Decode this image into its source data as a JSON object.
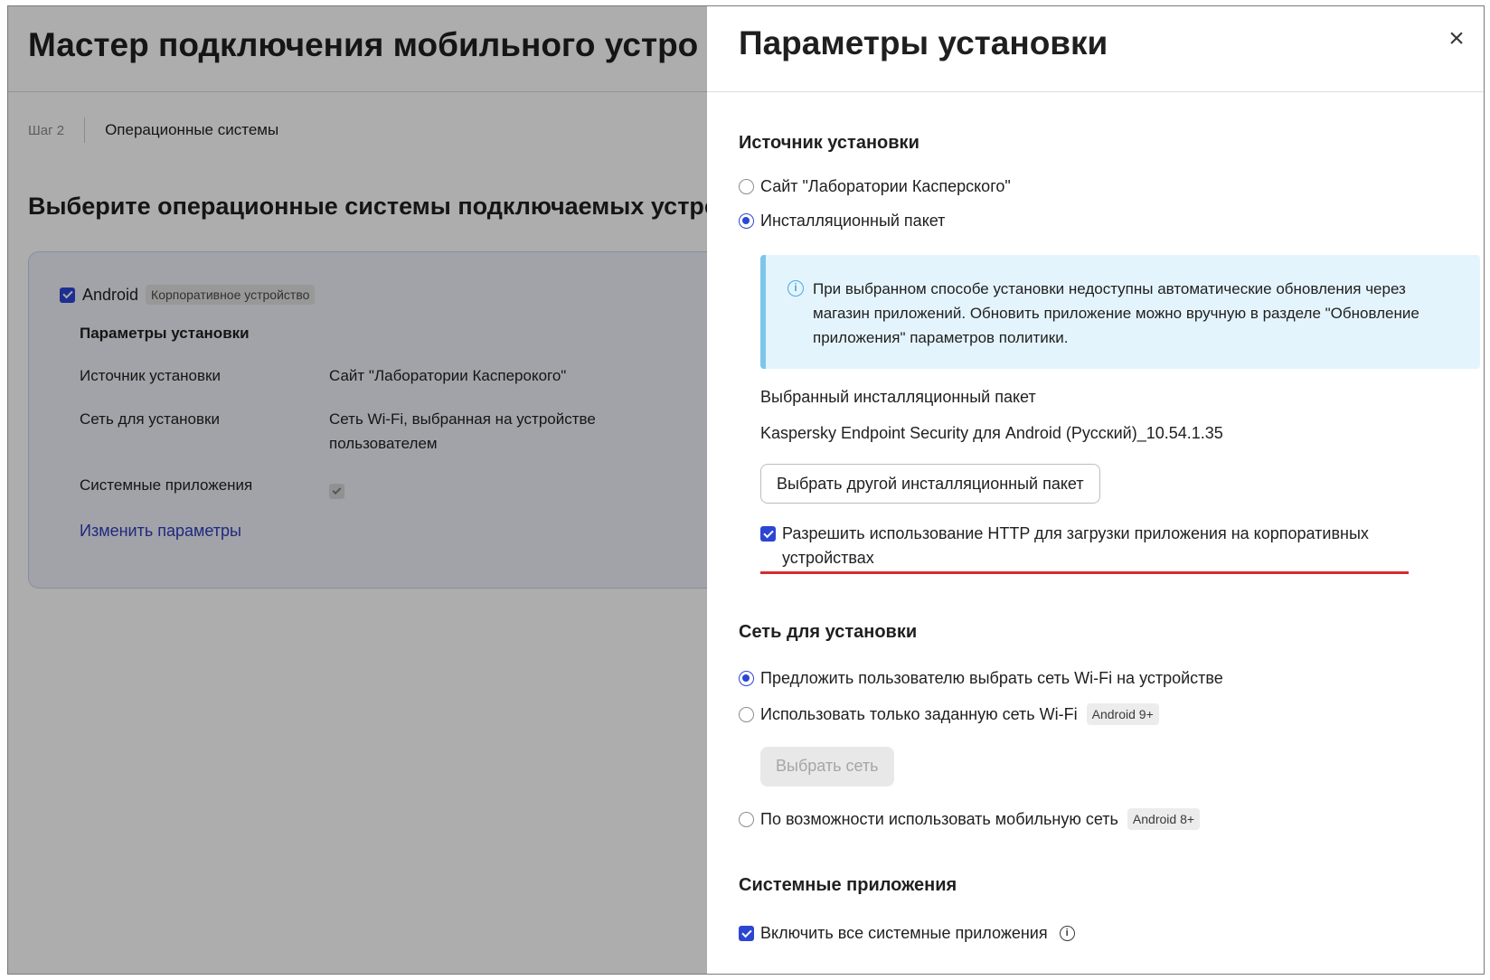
{
  "wizard": {
    "title": "Мастер подключения мобильного устро",
    "step_label": "Шаг 2",
    "step_name": "Операционные системы",
    "select_title": "Выберите операционные системы подключаемых устро",
    "os_card": {
      "os_name": "Android",
      "os_tag": "Корпоративное устройство",
      "params_title": "Параметры установки",
      "rows": [
        {
          "label": "Источник установки",
          "value": "Сайт \"Лаборатории Касперокого\""
        },
        {
          "label": "Сеть для установки",
          "value": "Сеть Wi-Fi, выбранная на устройстве пользователем"
        },
        {
          "label": "Системные приложения",
          "value": ""
        }
      ],
      "change_link": "Изменить параметры"
    }
  },
  "panel": {
    "title": "Параметры установки",
    "close_symbol": "×",
    "source": {
      "title": "Источник установки",
      "options": [
        {
          "label": "Сайт \"Лаборатории Касперского\"",
          "selected": false
        },
        {
          "label": "Инсталляционный пакет",
          "selected": true
        }
      ],
      "info_text": "При выбранном способе установки недоступны автоматические обновления через магазин приложений. Обновить приложение можно вручную в разделе \"Обновление приложения\" параметров политики.",
      "selected_package_label": "Выбранный инсталляционный пакет",
      "selected_package_value": "Kaspersky Endpoint Security для Android (Русский)_10.54.1.35",
      "choose_other_button": "Выбрать другой инсталляционный пакет",
      "allow_http_label": "Разрешить использование HTTP для загрузки приложения на корпоративных устройствах",
      "allow_http_checked": true
    },
    "network": {
      "title": "Сеть для установки",
      "options": [
        {
          "label": "Предложить пользователю выбрать сеть Wi-Fi на устройстве",
          "selected": true,
          "tag": ""
        },
        {
          "label": "Использовать только заданную сеть Wi-Fi",
          "selected": false,
          "tag": "Android 9+"
        },
        {
          "label": "По возможности использовать мобильную сеть",
          "selected": false,
          "tag": "Android 8+"
        }
      ],
      "choose_network_button": "Выбрать сеть"
    },
    "system_apps": {
      "title": "Системные приложения",
      "enable_all_label": "Включить все системные приложения",
      "enable_all_checked": true
    }
  },
  "colors": {
    "accent": "#2c46d4",
    "info_bg": "#e4f4fc",
    "info_border": "#7dc6ea",
    "highlight_line": "#d92b2b",
    "link": "#2e3cb8"
  }
}
